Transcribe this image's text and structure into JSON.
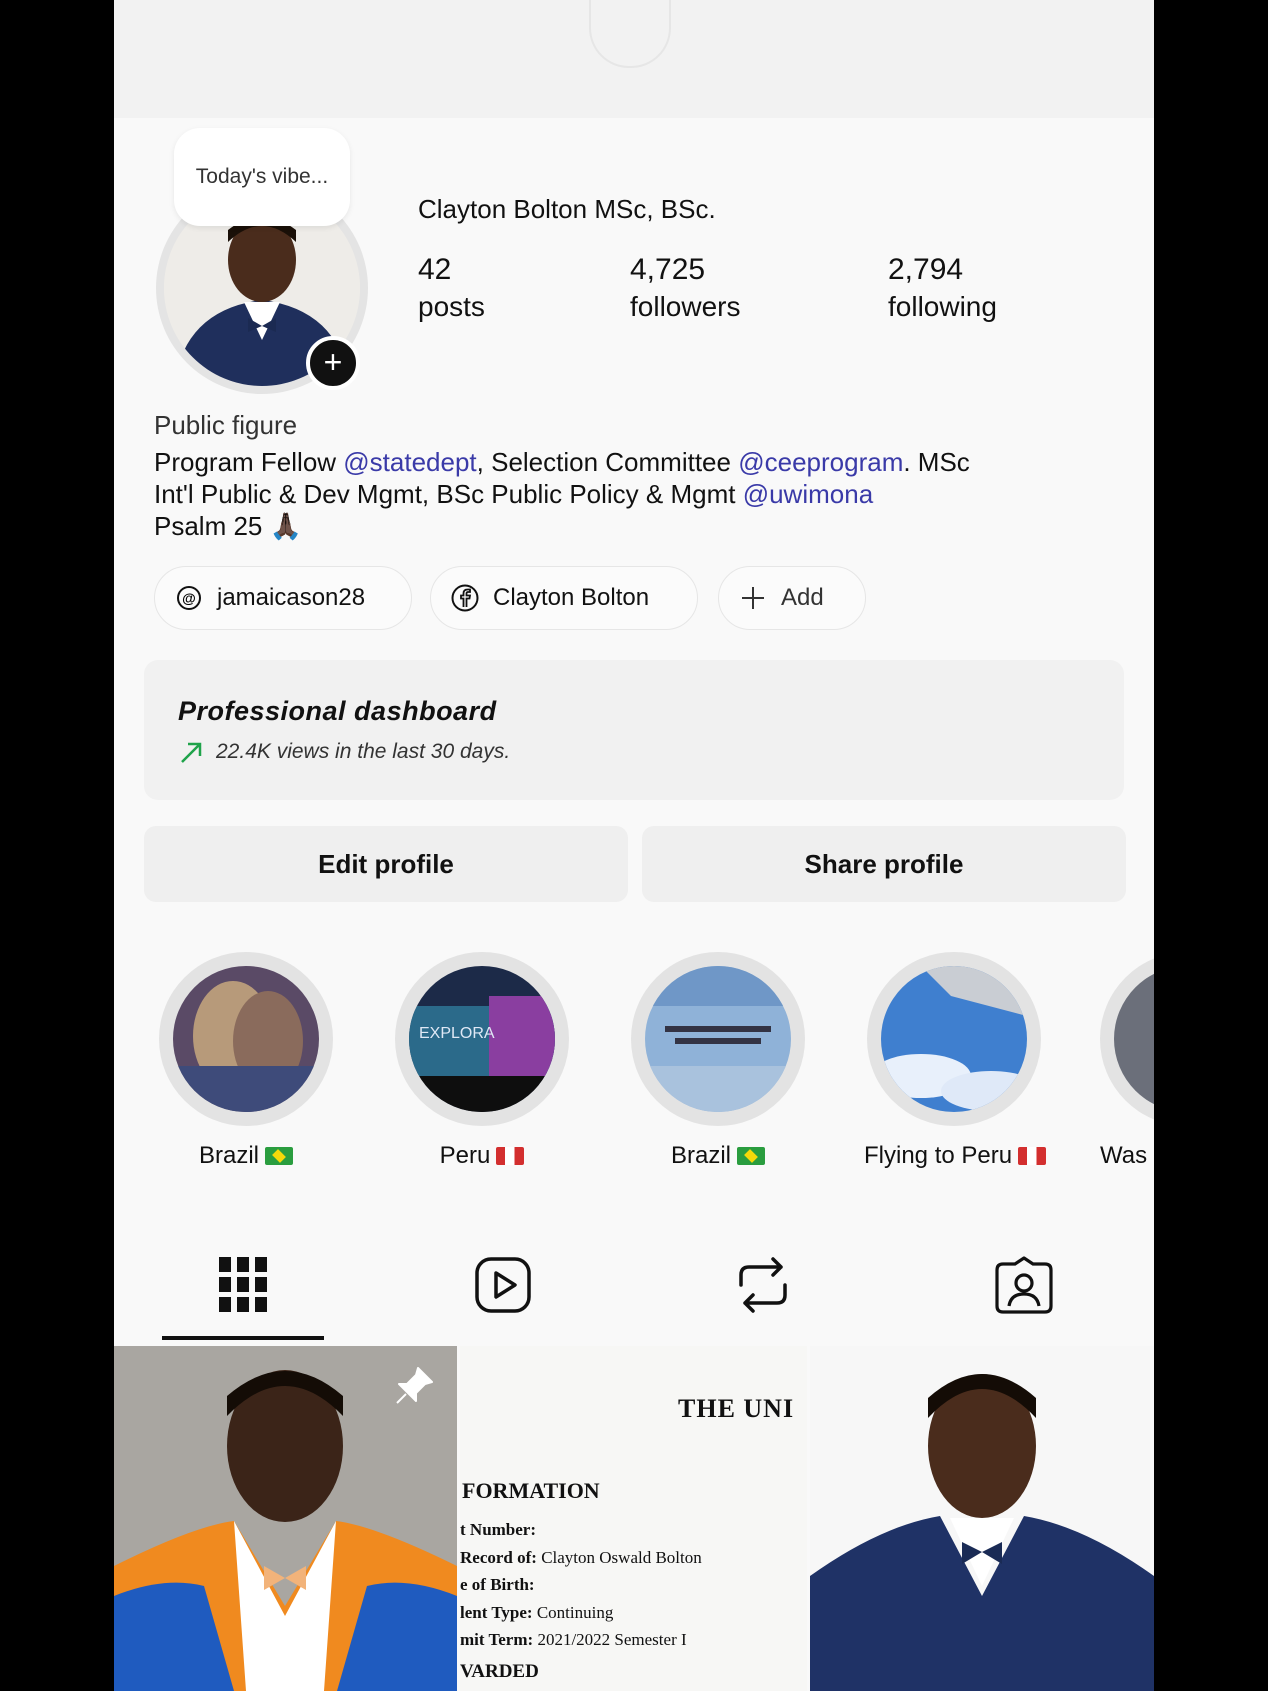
{
  "note": {
    "text": "Today's vibe..."
  },
  "profile": {
    "name": "Clayton Bolton MSc, BSc.",
    "stats": [
      {
        "value": "42",
        "label": "posts"
      },
      {
        "value": "4,725",
        "label": "followers"
      },
      {
        "value": "2,794",
        "label": "following"
      }
    ],
    "category": "Public figure",
    "bio": {
      "line1_a": "Program Fellow ",
      "mention1": "@statedept",
      "line1_b": ",  Selection Committee ",
      "mention2": "@ceeprogram",
      "line1_c": ". MSc",
      "line2_a": "Int'l Public & Dev Mgmt, BSc Public Policy & Mgmt ",
      "mention3": "@uwimona",
      "line3": "Psalm 25 🙏🏿"
    }
  },
  "links": [
    {
      "label": "jamaicason28",
      "icon": "threads-icon"
    },
    {
      "label": "Clayton Bolton",
      "icon": "facebook-icon"
    },
    {
      "label": "Add",
      "icon": "plus-icon"
    }
  ],
  "dashboard": {
    "title": "Professional dashboard",
    "subtitle": "22.4K views in the last 30 days.",
    "trend_color": "#1fa34a"
  },
  "buttons": {
    "edit": "Edit profile",
    "share": "Share profile"
  },
  "highlights": [
    {
      "label": "Brazil",
      "flag": "br"
    },
    {
      "label": "Peru",
      "flag": "pe"
    },
    {
      "label": "Brazil",
      "flag": "br"
    },
    {
      "label": "Flying to Peru",
      "flag": "pe"
    },
    {
      "label": "Was"
    }
  ],
  "tabs": [
    "grid-icon",
    "reels-icon",
    "reposts-icon",
    "tagged-icon"
  ],
  "posts": {
    "doc": {
      "heading": "THE UNI",
      "section": "FORMATION",
      "row1": "t Number:",
      "row2_label": "Record of:",
      "row2_value": "Clayton Oswald Bolton",
      "row3": "e of Birth:",
      "row4_label": "lent Type:",
      "row4_value": "Continuing",
      "row5_label": "mit Term:",
      "row5_value": "2021/2022 Semester I",
      "row6": "VARDED"
    }
  }
}
